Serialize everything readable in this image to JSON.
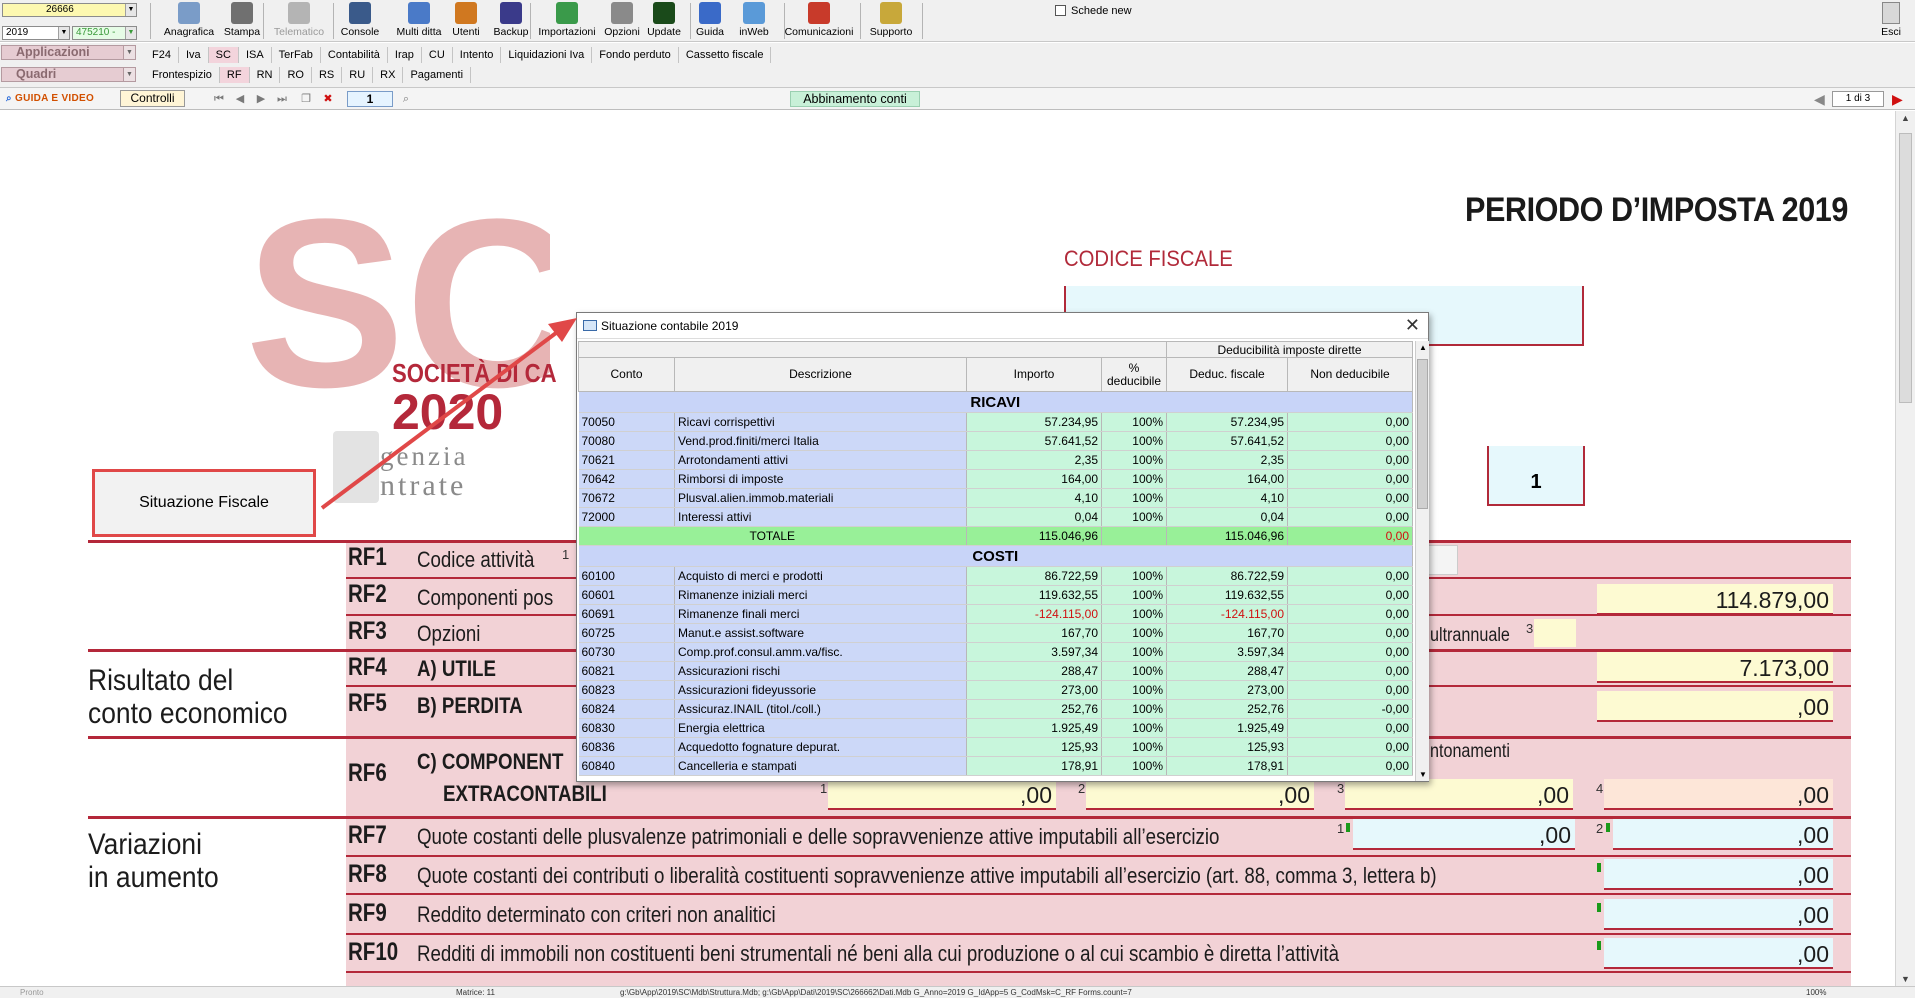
{
  "toolbar": {
    "company_combo": "26666",
    "year_combo": "2019",
    "code_combo": "475210 -",
    "buttons": [
      {
        "label": "Anagrafica",
        "icon": "registry-icon",
        "color": "#7a9cc8"
      },
      {
        "label": "Stampa",
        "icon": "printer-icon",
        "color": "#707070"
      },
      {
        "label": "Telematico",
        "icon": "telematic-icon",
        "color": "#b4b4b4"
      },
      {
        "label": "Console",
        "icon": "console-icon",
        "color": "#3a5a8a"
      },
      {
        "label": "Multi ditta",
        "icon": "multi-company-icon",
        "color": "#4a7ac8"
      },
      {
        "label": "Utenti",
        "icon": "users-icon",
        "color": "#d07820"
      },
      {
        "label": "Backup",
        "icon": "backup-icon",
        "color": "#3a3a8a"
      },
      {
        "label": "Importazioni",
        "icon": "import-icon",
        "color": "#3a9a4a"
      },
      {
        "label": "Opzioni",
        "icon": "options-icon",
        "color": "#8a8a8a"
      },
      {
        "label": "Update",
        "icon": "update-icon",
        "color": "#1a4a1a"
      },
      {
        "label": "Guida",
        "icon": "help-icon",
        "color": "#3a6ac8"
      },
      {
        "label": "inWeb",
        "icon": "cloud-icon",
        "color": "#5a9ad8"
      },
      {
        "label": "Comunicazioni",
        "icon": "communications-icon",
        "color": "#c83a2a"
      },
      {
        "label": "Supporto",
        "icon": "support-icon",
        "color": "#c8a83a"
      }
    ],
    "schede_new": "Schede new",
    "exit_label": "Esci"
  },
  "nav": {
    "applicazioni_label": "Applicazioni",
    "quadri_label": "Quadri",
    "app_tabs": [
      "F24",
      "Iva",
      "SC",
      "ISA",
      "TerFab",
      "Contabilità",
      "Irap",
      "CU",
      "Intento",
      "Liquidazioni Iva",
      "Fondo perduto",
      "Cassetto fiscale"
    ],
    "app_tab_active": "SC",
    "quadri_tabs": [
      "Frontespizio",
      "RF",
      "RN",
      "RO",
      "RS",
      "RU",
      "RX",
      "Pagamenti"
    ],
    "quadri_tab_active": "RF"
  },
  "controls": {
    "guida_video": "GUIDA E VIDEO",
    "controlli": "Controlli",
    "page_input": "1",
    "abbinamento": "Abbinamento conti",
    "page_count": "1 di 3"
  },
  "form": {
    "periodo": "PERIODO D’IMPOSTA 2019",
    "codice_fiscale_label": "CODICE FISCALE",
    "modello_number": "1",
    "situazione_fiscale_button": "Situazione Fiscale",
    "logo": {
      "letters": "SC",
      "line1": "SOCIETÀ DI CA",
      "year": "2020",
      "agency1": "genzia",
      "agency2": "ntrate"
    },
    "section_risultato": [
      "Risultato del",
      "conto economico"
    ],
    "section_variazioni": [
      "Variazioni",
      "in aumento"
    ],
    "rows": [
      {
        "code": "RF1",
        "text": "Codice attività",
        "num": "1"
      },
      {
        "code": "RF2",
        "text": "Componenti pos",
        "value": "114.879",
        "dec": ",00"
      },
      {
        "code": "RF3",
        "text": "Opzioni",
        "extra": "ultrannuale",
        "num": "3"
      },
      {
        "code": "RF4",
        "text": "A) UTILE",
        "value": "7.173",
        "dec": ",00"
      },
      {
        "code": "RF5",
        "text": "B) PERDITA",
        "value": "",
        "dec": ",00"
      },
      {
        "code": "RF6",
        "text": "C) COMPONENT",
        "text2": "EXTRACONTABILI",
        "extra": "ntonamenti"
      },
      {
        "code": "RF7",
        "text": "Quote costanti delle plusvalenze patrimoniali e delle sopravvenienze attive imputabili all’esercizio"
      },
      {
        "code": "RF8",
        "text": "Quote costanti dei contributi o liberalità costituenti sopravvenienze attive imputabili all’esercizio (art. 88, comma 3, lettera b)"
      },
      {
        "code": "RF9",
        "text": "Reddito determinato con criteri non analitici"
      },
      {
        "code": "RF10",
        "text": "Redditi di immobili non costituenti beni strumentali né beni alla cui produzione o al cui scambio è diretta l’attività"
      }
    ],
    "zero_dec": ",00",
    "field_nums": [
      "1",
      "2",
      "3",
      "4"
    ]
  },
  "popup": {
    "title": "Situazione contabile 2019",
    "group_header": "Deducibilità imposte dirette",
    "columns": [
      "Conto",
      "Descrizione",
      "Importo",
      "% deducibile",
      "Deduc. fiscale",
      "Non deducibile"
    ],
    "ricavi_label": "RICAVI",
    "costi_label": "COSTI",
    "ricavi": [
      {
        "conto": "70050",
        "desc": "Ricavi corrispettivi",
        "importo": "57.234,95",
        "pct": "100%",
        "ded": "57.234,95",
        "nd": "0,00"
      },
      {
        "conto": "70080",
        "desc": "Vend.prod.finiti/merci Italia",
        "importo": "57.641,52",
        "pct": "100%",
        "ded": "57.641,52",
        "nd": "0,00"
      },
      {
        "conto": "70621",
        "desc": "Arrotondamenti attivi",
        "importo": "2,35",
        "pct": "100%",
        "ded": "2,35",
        "nd": "0,00"
      },
      {
        "conto": "70642",
        "desc": "Rimborsi di imposte",
        "importo": "164,00",
        "pct": "100%",
        "ded": "164,00",
        "nd": "0,00"
      },
      {
        "conto": "70672",
        "desc": "Plusval.alien.immob.materiali",
        "importo": "4,10",
        "pct": "100%",
        "ded": "4,10",
        "nd": "0,00"
      },
      {
        "conto": "72000",
        "desc": "Interessi attivi",
        "importo": "0,04",
        "pct": "100%",
        "ded": "0,04",
        "nd": "0,00"
      }
    ],
    "totale": {
      "label": "TOTALE",
      "importo": "115.046,96",
      "ded": "115.046,96",
      "nd": "0,00"
    },
    "costi": [
      {
        "conto": "60100",
        "desc": "Acquisto di merci e prodotti",
        "importo": "86.722,59",
        "pct": "100%",
        "ded": "86.722,59",
        "nd": "0,00"
      },
      {
        "conto": "60601",
        "desc": "Rimanenze iniziali merci",
        "importo": "119.632,55",
        "pct": "100%",
        "ded": "119.632,55",
        "nd": "0,00"
      },
      {
        "conto": "60691",
        "desc": "Rimanenze finali merci",
        "importo": "-124.115,00",
        "pct": "100%",
        "ded": "-124.115,00",
        "nd": "0,00",
        "neg": true
      },
      {
        "conto": "60725",
        "desc": "Manut.e assist.software",
        "importo": "167,70",
        "pct": "100%",
        "ded": "167,70",
        "nd": "0,00"
      },
      {
        "conto": "60730",
        "desc": "Comp.prof.consul.amm.va/fisc.",
        "importo": "3.597,34",
        "pct": "100%",
        "ded": "3.597,34",
        "nd": "0,00"
      },
      {
        "conto": "60821",
        "desc": "Assicurazioni rischi",
        "importo": "288,47",
        "pct": "100%",
        "ded": "288,47",
        "nd": "0,00"
      },
      {
        "conto": "60823",
        "desc": "Assicurazioni fideyussorie",
        "importo": "273,00",
        "pct": "100%",
        "ded": "273,00",
        "nd": "0,00"
      },
      {
        "conto": "60824",
        "desc": "Assicuraz.INAIL (titol./coll.)",
        "importo": "252,76",
        "pct": "100%",
        "ded": "252,76",
        "nd": "-0,00"
      },
      {
        "conto": "60830",
        "desc": "Energia elettrica",
        "importo": "1.925,49",
        "pct": "100%",
        "ded": "1.925,49",
        "nd": "0,00"
      },
      {
        "conto": "60836",
        "desc": "Acquedotto fognature depurat.",
        "importo": "125,93",
        "pct": "100%",
        "ded": "125,93",
        "nd": "0,00"
      },
      {
        "conto": "60840",
        "desc": "Cancelleria e stampati",
        "importo": "178,91",
        "pct": "100%",
        "ded": "178,91",
        "nd": "0,00"
      }
    ]
  },
  "status": {
    "left": "Pronto",
    "matrice": "Matrice: 11",
    "path": "g:\\Gb\\App\\2019\\SC\\Mdb\\Struttura.Mdb; g:\\Gb\\App\\Dati\\2019\\SC\\266662\\Dati.Mdb G_Anno=2019 G_IdApp=5 G_CodMsk=C_RF Forms.count=7",
    "zoom": "100%"
  },
  "colors": {
    "accent_red": "#b4283a",
    "pink": "#f2d2d6",
    "arrow": "#e04848"
  }
}
